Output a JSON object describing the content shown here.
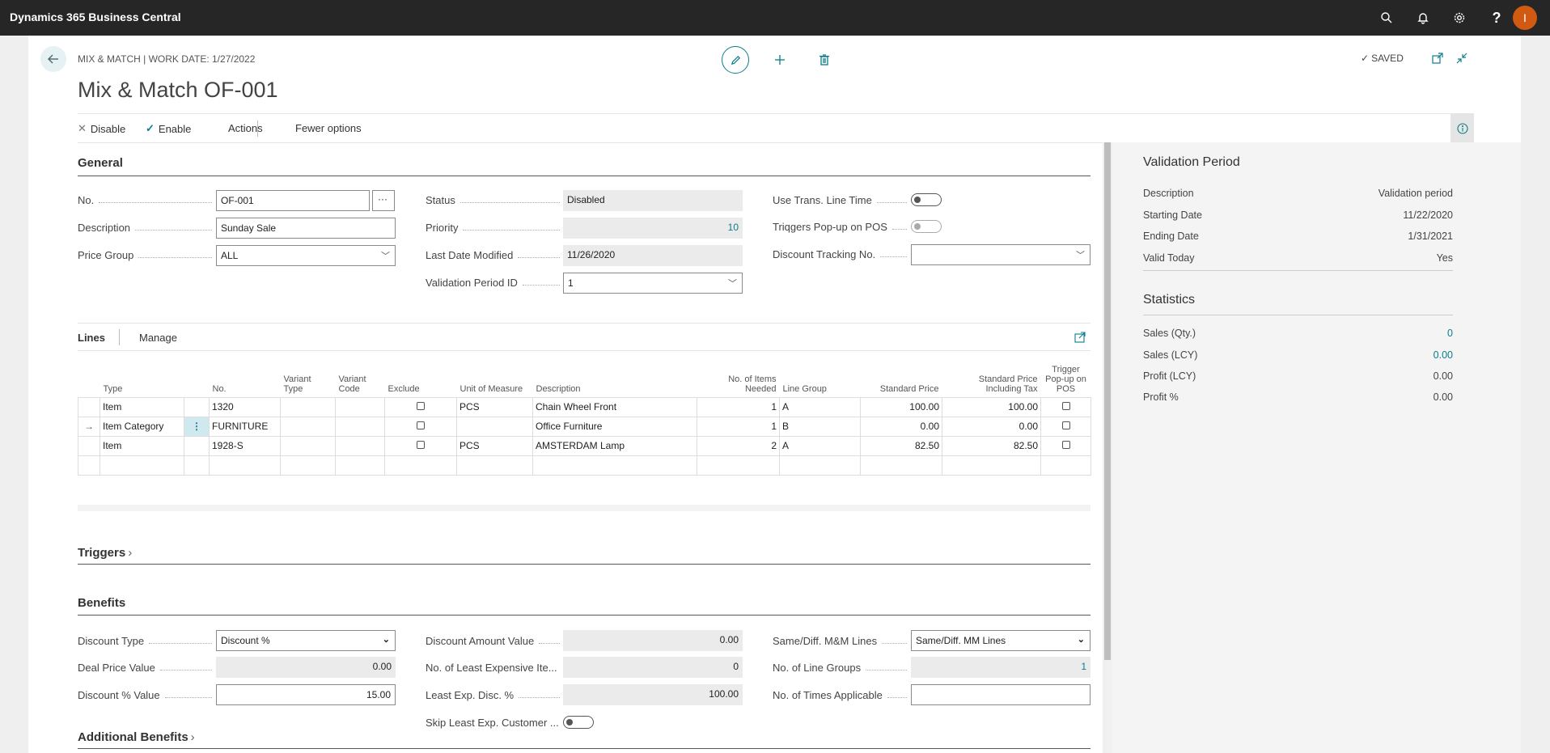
{
  "app": {
    "title": "Dynamics 365 Business Central",
    "avatar_initial": "I"
  },
  "header": {
    "breadcrumb": "MIX & MATCH | WORK DATE: 1/27/2022",
    "title": "Mix & Match OF-001",
    "saved_label": "SAVED"
  },
  "actions": {
    "disable": "Disable",
    "enable": "Enable",
    "actions": "Actions",
    "fewer": "Fewer options"
  },
  "general": {
    "title": "General",
    "no_label": "No.",
    "no_value": "OF-001",
    "desc_label": "Description",
    "desc_value": "Sunday Sale",
    "price_group_label": "Price Group",
    "price_group_value": "ALL",
    "status_label": "Status",
    "status_value": "Disabled",
    "priority_label": "Priority",
    "priority_value": "10",
    "last_modified_label": "Last Date Modified",
    "last_modified_value": "11/26/2020",
    "validation_id_label": "Validation Period ID",
    "validation_id_value": "1",
    "use_trans_label": "Use Trans. Line Time",
    "trigger_popup_label": "Triqgers Pop-up on POS",
    "tracking_label": "Discount Tracking No.",
    "tracking_value": ""
  },
  "lines": {
    "tab_lines": "Lines",
    "tab_manage": "Manage",
    "columns": [
      "Type",
      "No.",
      "Variant Type",
      "Variant Code",
      "Exclude",
      "Unit of Measure",
      "Description",
      "No. of Items Needed",
      "Line Group",
      "Standard Price",
      "Standard Price Including Tax",
      "Trigger Pop-up on POS"
    ],
    "rows": [
      {
        "type": "Item",
        "no": "1320",
        "variant_type": "",
        "variant_code": "",
        "uom": "PCS",
        "description": "Chain Wheel Front",
        "items_needed": "1",
        "line_group": "A",
        "std_price": "100.00",
        "std_price_tax": "100.00"
      },
      {
        "type": "Item Category",
        "no": "FURNITURE",
        "variant_type": "",
        "variant_code": "",
        "uom": "",
        "description": "Office Furniture",
        "items_needed": "1",
        "line_group": "B",
        "std_price": "0.00",
        "std_price_tax": "0.00"
      },
      {
        "type": "Item",
        "no": "1928-S",
        "variant_type": "",
        "variant_code": "",
        "uom": "PCS",
        "description": "AMSTERDAM Lamp",
        "items_needed": "2",
        "line_group": "A",
        "std_price": "82.50",
        "std_price_tax": "82.50"
      }
    ]
  },
  "triggers": {
    "title": "Triggers"
  },
  "benefits": {
    "title": "Benefits",
    "disc_type_label": "Discount Type",
    "disc_type_value": "Discount %",
    "deal_price_label": "Deal Price Value",
    "deal_price_value": "0.00",
    "disc_pct_label": "Discount % Value",
    "disc_pct_value": "15.00",
    "disc_amount_label": "Discount Amount Value",
    "disc_amount_value": "0.00",
    "least_exp_items_label": "No. of Least Expensive Ite...",
    "least_exp_items_value": "0",
    "least_exp_disc_label": "Least Exp. Disc. %",
    "least_exp_disc_value": "100.00",
    "skip_least_label": "Skip Least Exp. Customer ...",
    "same_diff_label": "Same/Diff. M&M Lines",
    "same_diff_value": "Same/Diff. MM Lines",
    "line_groups_label": "No. of Line Groups",
    "line_groups_value": "1",
    "times_applicable_label": "No. of Times Applicable",
    "times_applicable_value": ""
  },
  "additional_benefits": {
    "title": "Additional Benefits"
  },
  "factbox": {
    "validation_title": "Validation Period",
    "validation": [
      {
        "label": "Description",
        "value": "Validation period"
      },
      {
        "label": "Starting Date",
        "value": "11/22/2020"
      },
      {
        "label": "Ending Date",
        "value": "1/31/2021"
      },
      {
        "label": "Valid Today",
        "value": "Yes"
      }
    ],
    "statistics_title": "Statistics",
    "statistics": [
      {
        "label": "Sales (Qty.)",
        "value": "0"
      },
      {
        "label": "Sales (LCY)",
        "value": "0.00"
      },
      {
        "label": "Profit (LCY)",
        "value": "0.00"
      },
      {
        "label": "Profit %",
        "value": "0.00"
      }
    ]
  },
  "colors": {
    "accent": "#0a7d8c",
    "topbar": "#262626",
    "avatar": "#d05a12"
  }
}
